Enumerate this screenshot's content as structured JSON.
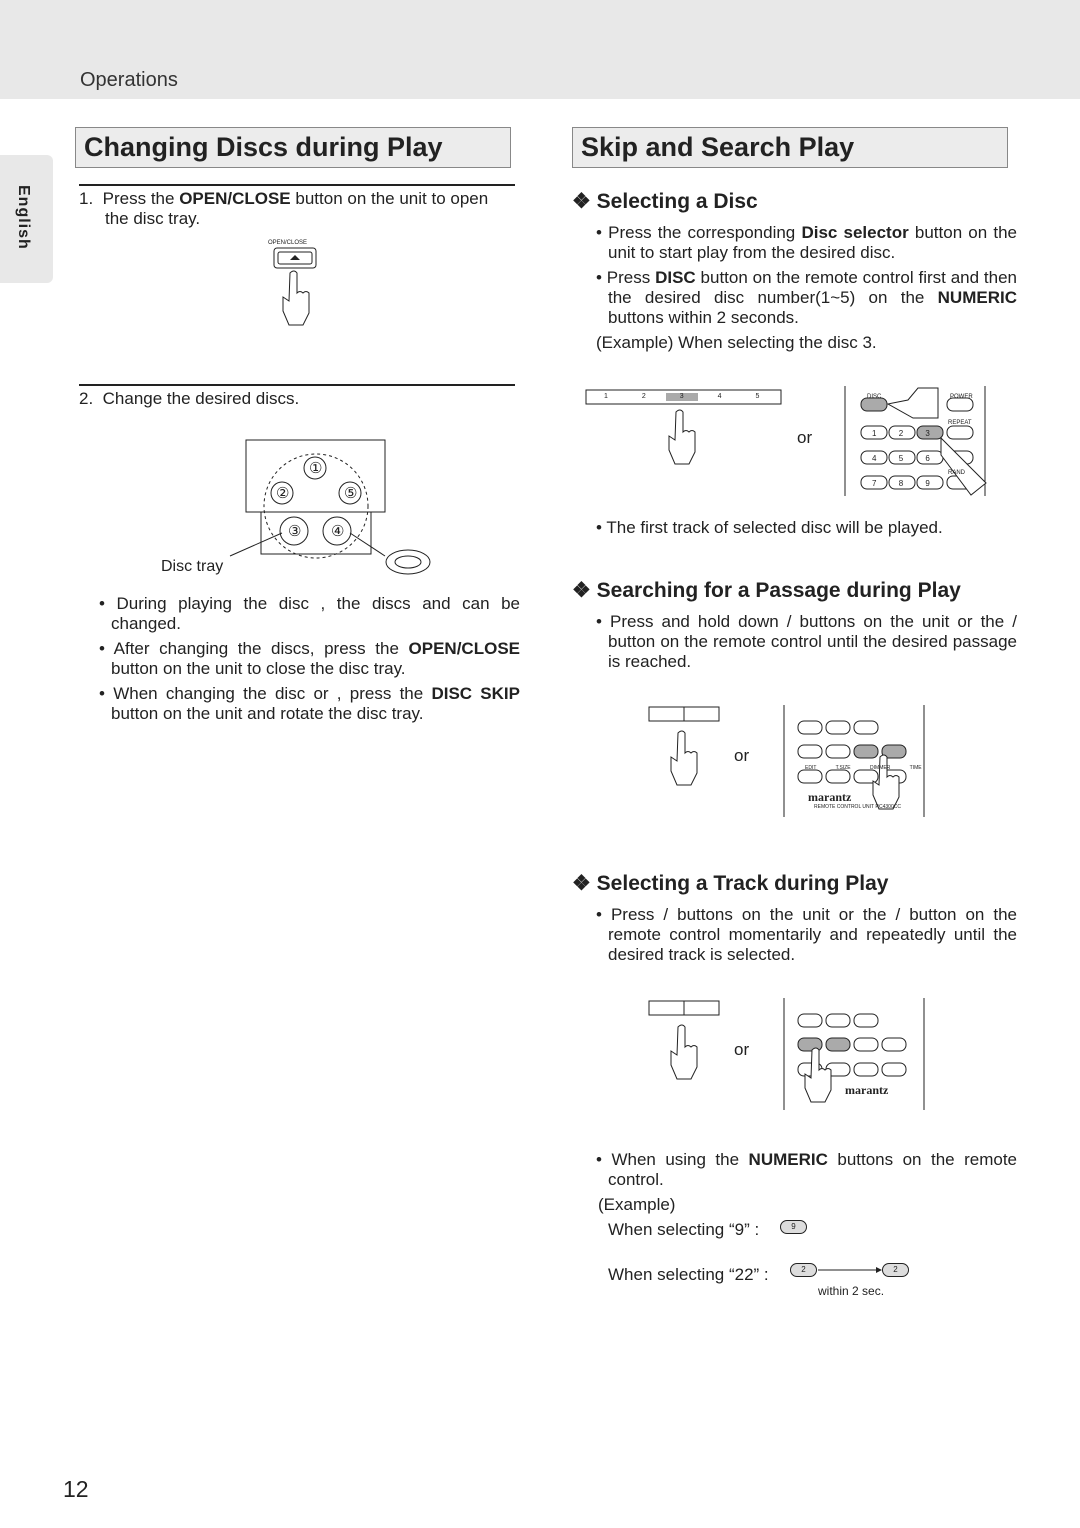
{
  "header": {
    "section": "Operations"
  },
  "tab": {
    "language": "English"
  },
  "left": {
    "title": "Changing Discs during Play",
    "step1": {
      "num": "1.",
      "pre": "Press the ",
      "bold": "OPEN/CLOSE",
      "post": " button on the unit to open the disc tray."
    },
    "open_close_label": "OPEN/CLOSE",
    "step2": {
      "num": "2.",
      "text": "Change the desired discs."
    },
    "disc_numbers": [
      "①",
      "②",
      "⑤",
      "③",
      "④"
    ],
    "disc_tray_label": "Disc tray",
    "bullets": [
      {
        "pre": "During playing the disc     , the discs     and     can be changed."
      },
      {
        "pre": "After changing the discs, press the ",
        "bold": "OPEN/CLOSE",
        "post": " button on the unit to close the disc tray."
      },
      {
        "pre": "When changing the disc     or     , press the ",
        "bold": "DISC SKIP",
        "post": " button on the unit and rotate the disc tray."
      }
    ]
  },
  "right": {
    "title": "Skip and Search Play",
    "sec1": {
      "heading": "Selecting a Disc",
      "b1": {
        "pre": "Press the corresponding ",
        "bold": "Disc selector",
        "post": " button on the unit to start play from the desired disc."
      },
      "b2": {
        "pre": "Press ",
        "bold": "DISC",
        "mid": " button on the remote control first and then the desired disc number(1~5) on the ",
        "bold2": "NUMERIC",
        "post": " buttons within 2 seconds."
      },
      "example": "(Example) When selecting the disc 3.",
      "or": "or",
      "selector_nums": [
        "1",
        "2",
        "3",
        "4",
        "5"
      ],
      "remote_labels": {
        "disc": "DISC",
        "power": "POWER",
        "repeat": "REPEAT",
        "rand": "RAND"
      },
      "remote_nums": [
        "1",
        "2",
        "3",
        "4",
        "5",
        "6",
        "7",
        "8",
        "9"
      ],
      "note": "The first track of selected disc will be played."
    },
    "sec2": {
      "heading": "Searching for a Passage during Play",
      "b1": "Press and hold down      /      buttons on the unit or the      /      button on the remote control until the desired passage is reached.",
      "or": "or",
      "remote_labels": [
        "EDIT",
        "T.SIZE",
        "DIMMER",
        "TIME"
      ],
      "brand": "marantz",
      "remote_name": "REMOTE CONTROL UNIT RC4300CC"
    },
    "sec3": {
      "heading": "Selecting a Track during Play",
      "b1": "Press      /      buttons on the unit or the      /      button on the remote control momentarily and repeatedly until the desired track is selected.",
      "or": "or",
      "b2": {
        "pre": "When using the ",
        "bold": "NUMERIC",
        "post": " buttons on the remote control."
      },
      "example": "(Example)",
      "ex9": "When selecting “9” :",
      "ex22": "When selecting “22” :",
      "key9": "9",
      "key2": "2",
      "within": "within 2 sec."
    }
  },
  "page_number": "12"
}
